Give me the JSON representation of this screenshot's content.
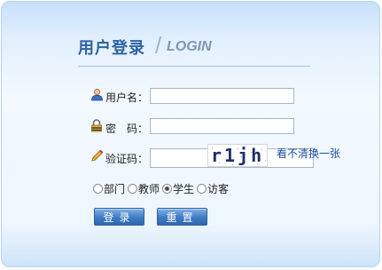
{
  "header": {
    "title": "用户登录",
    "subtitle": "LOGIN"
  },
  "form": {
    "username_label": "用户名：",
    "username_value": "",
    "password_label": "密　码：",
    "password_value": "",
    "captcha_label": "验证码：",
    "captcha_value": "",
    "captcha_image_text": "r1jh",
    "captcha_refresh": "看不清换一张"
  },
  "roles": {
    "items": [
      {
        "label": "部门",
        "checked": false
      },
      {
        "label": "教师",
        "checked": false
      },
      {
        "label": "学生",
        "checked": true
      },
      {
        "label": "访客",
        "checked": false
      }
    ]
  },
  "buttons": {
    "login": "登录",
    "reset": "重置"
  },
  "icons": {
    "username": "user-icon",
    "password": "lock-icon",
    "captcha": "pencil-icon"
  }
}
